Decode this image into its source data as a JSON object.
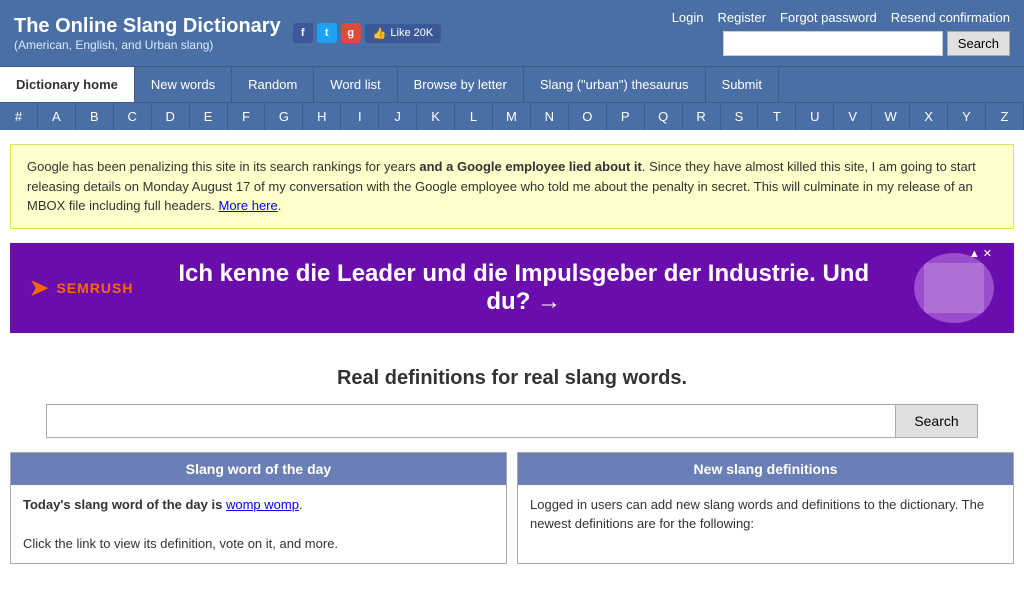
{
  "header": {
    "title": "The Online Slang Dictionary",
    "subtitle": "(American, English, and Urban slang)",
    "links": [
      "Login",
      "Register",
      "Forgot password",
      "Resend confirmation"
    ],
    "search_placeholder": "",
    "search_button": "Search",
    "like_text": "Like 20K",
    "social": [
      {
        "name": "facebook",
        "label": "f"
      },
      {
        "name": "twitter",
        "label": "t"
      },
      {
        "name": "google-plus",
        "label": "g"
      }
    ]
  },
  "nav": {
    "items": [
      {
        "label": "Dictionary home",
        "active": true
      },
      {
        "label": "New words",
        "active": false
      },
      {
        "label": "Random",
        "active": false
      },
      {
        "label": "Word list",
        "active": false
      },
      {
        "label": "Browse by letter",
        "active": false
      },
      {
        "label": "Slang (\"urban\") thesaurus",
        "active": false
      },
      {
        "label": "Submit",
        "active": false
      }
    ]
  },
  "letters": [
    "#",
    "A",
    "B",
    "C",
    "D",
    "E",
    "F",
    "G",
    "H",
    "I",
    "J",
    "K",
    "L",
    "M",
    "N",
    "O",
    "P",
    "Q",
    "R",
    "S",
    "T",
    "U",
    "V",
    "W",
    "X",
    "Y",
    "Z"
  ],
  "notice": {
    "text_plain": "Google has been penalizing this site in its search rankings for years ",
    "text_bold": "and a Google employee lied about it",
    "text_plain2": ". Since they have almost killed this site, I am going to start releasing details on Monday August 17 of my conversation with the Google employee who told me about the penalty in secret. This will culminate in my release of an MBOX file including full headers. ",
    "link_text": "More here",
    "link_url": "#"
  },
  "ad": {
    "logo": "SEMRUSH",
    "tagline": "Ich kenne die Leader und die Impulsgeber der Industrie. Und du? →",
    "close_icons": [
      "▲",
      "✕"
    ]
  },
  "main": {
    "heading": "Real definitions for real slang words.",
    "search_placeholder": "",
    "search_button": "Search"
  },
  "cards": [
    {
      "header": "Slang word of the day",
      "body_prefix": "Today's slang word of the day is ",
      "word": "womp womp",
      "body_suffix": ".",
      "body_extra": "Click the link to view its definition, vote on it, and more."
    },
    {
      "header": "New slang definitions",
      "body": "Logged in users can add new slang words and definitions to the dictionary. The newest definitions are for the following:"
    }
  ]
}
